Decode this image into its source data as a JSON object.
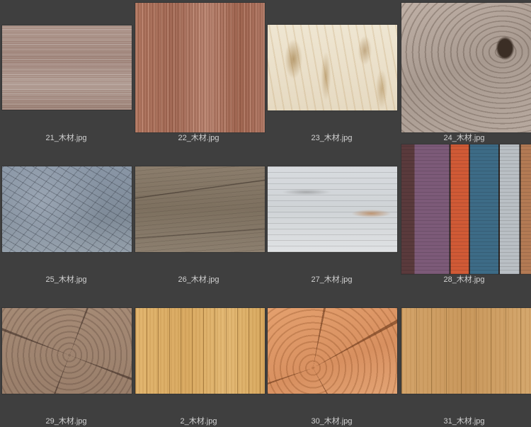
{
  "items": [
    {
      "filename": "21_木材.jpg"
    },
    {
      "filename": "22_木材.jpg"
    },
    {
      "filename": "23_木材.jpg"
    },
    {
      "filename": "24_木材.jpg"
    },
    {
      "filename": "25_木材.jpg"
    },
    {
      "filename": "26_木材.jpg"
    },
    {
      "filename": "27_木材.jpg"
    },
    {
      "filename": "28_木材.jpg"
    },
    {
      "filename": "29_木材.jpg"
    },
    {
      "filename": "2_木材.jpg"
    },
    {
      "filename": "30_木材.jpg"
    },
    {
      "filename": "31_木材.jpg"
    }
  ]
}
